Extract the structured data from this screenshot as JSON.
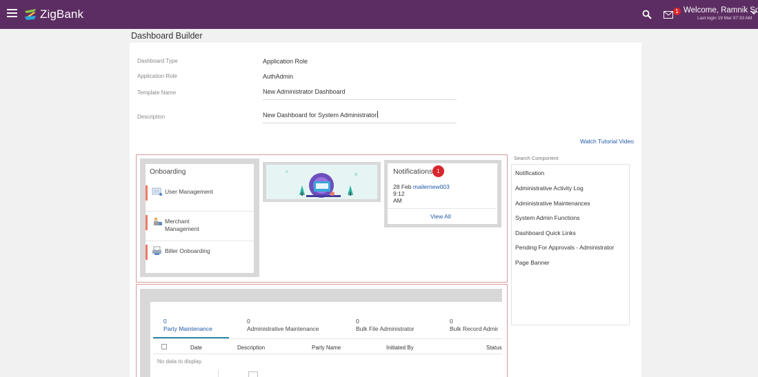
{
  "header": {
    "logo_text": "ZigBank",
    "welcome": "Welcome, Ramnik Sodhi",
    "last_login": "Last login 19 Mar 07:33 AM",
    "mail_count": "1",
    "colors": {
      "bar": "#5c2d62",
      "badge": "#d9262c"
    },
    "icons": [
      "hamburger-icon",
      "zigbank-logo-icon",
      "search-icon",
      "mail-icon",
      "chevron-down-icon"
    ]
  },
  "page": {
    "title": "Dashboard Builder"
  },
  "form": {
    "dashboard_type_label": "Dashboard Type",
    "dashboard_type_value": "Application Role",
    "application_role_label": "Application Role",
    "application_role_value": "AuthAdmin",
    "template_name_label": "Template Name",
    "template_name_value": "New Administrator Dashboard",
    "description_label": "Description",
    "description_value": "New Dashboard for System Administrator"
  },
  "tutorial_link": "Watch Tutorial Video",
  "onboarding": {
    "title": "Onboarding",
    "items": [
      {
        "label": "User Management",
        "icon": "user-management-icon"
      },
      {
        "label": "Merchant Management",
        "icon": "merchant-management-icon"
      },
      {
        "label": "Biller Onboarding",
        "icon": "biller-onboarding-icon"
      }
    ]
  },
  "notifications": {
    "title": "Notifications",
    "count": "1",
    "date": "28 Feb",
    "user": "mailernew003",
    "time_line1": "9:12",
    "time_line2": "AM",
    "view_all": "View All"
  },
  "components": {
    "search_label": "Search Component",
    "items": [
      "Notification",
      "Administrative Activity Log",
      "Administrative Maintenances",
      "System Admin Functions",
      "Dashboard Quick Links",
      "Pending For Approvals - Administrator",
      "Page Banner"
    ]
  },
  "approvals": {
    "tabs": [
      {
        "count": "0",
        "label": "Party Maintenance"
      },
      {
        "count": "0",
        "label": "Administrative Maintenance"
      },
      {
        "count": "0",
        "label": "Bulk File Administrator"
      },
      {
        "count": "0",
        "label": "Bulk Record Admir"
      }
    ],
    "columns": [
      "Date",
      "Description",
      "Party Name",
      "Initiated By",
      "Status"
    ],
    "empty_text": "No data to display."
  }
}
